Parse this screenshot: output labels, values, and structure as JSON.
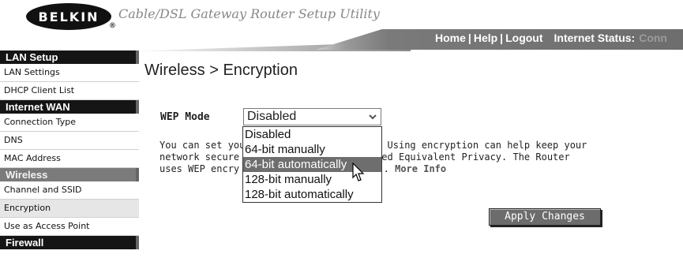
{
  "header": {
    "logo_text": "BELKIN",
    "logo_mark": "®",
    "app_title": "Cable/DSL Gateway Router Setup Utility",
    "nav": [
      "Home",
      "Help",
      "Logout"
    ],
    "nav_separator": "|",
    "status_label": "Internet Status:",
    "status_value": "Conn"
  },
  "sidebar": {
    "sections": [
      {
        "label": "LAN Setup",
        "style": "dark",
        "items": [
          "LAN Settings",
          "DHCP Client List"
        ]
      },
      {
        "label": "Internet WAN",
        "style": "dark",
        "items": [
          "Connection Type",
          "DNS",
          "MAC Address"
        ]
      },
      {
        "label": "Wireless",
        "style": "gray",
        "items": [
          "Channel and SSID",
          "Encryption",
          "Use as Access Point"
        ]
      },
      {
        "label": "Firewall",
        "style": "dark",
        "items": []
      }
    ],
    "active_item": "Encryption"
  },
  "main": {
    "title": "Wireless > Encryption",
    "wep_label": "WEP Mode",
    "selected_value": "Disabled",
    "description_parts": [
      "You can set you",
      "e. Using encryption can help keep your",
      "network secure",
      "Wired Equivalent Privacy. The Router",
      "uses WEP encry",
      "."
    ],
    "more_info": "More Info",
    "dropdown_options": [
      "Disabled",
      "64-bit manually",
      "64-bit automatically",
      "128-bit manually",
      "128-bit automatically"
    ],
    "highlighted_option": "64-bit automatically",
    "apply_label": "Apply Changes"
  },
  "colors": {
    "sidebar_dark": "#151515",
    "sidebar_gray": "#7b7b7b",
    "highlight": "#6e6e6e",
    "button": "#6c6c6c"
  }
}
